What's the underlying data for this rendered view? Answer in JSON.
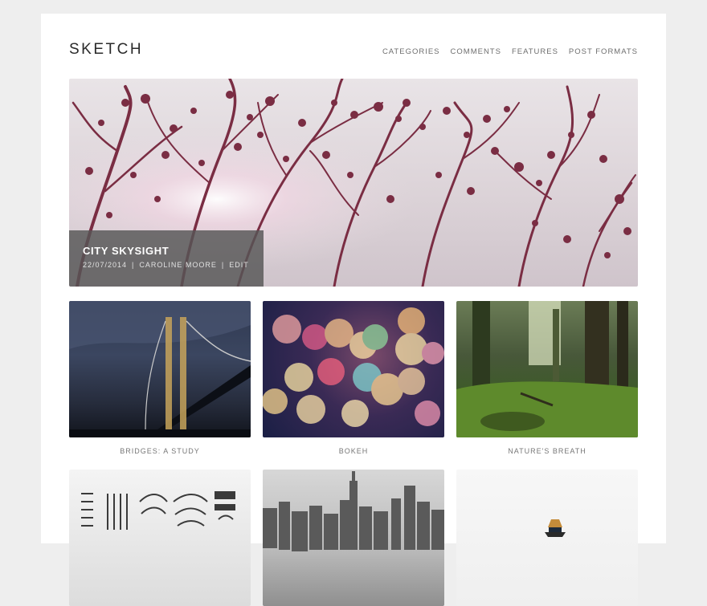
{
  "site": {
    "title": "SKETCH"
  },
  "nav": {
    "items": [
      "CATEGORIES",
      "COMMENTS",
      "FEATURES",
      "POST FORMATS"
    ]
  },
  "featured": {
    "title": "CITY SKYSIGHT",
    "date": "22/07/2014",
    "author": "CAROLINE MOORE",
    "edit_label": "EDIT",
    "separator": "|"
  },
  "projects": [
    {
      "title": "BRIDGES: A STUDY"
    },
    {
      "title": "BOKEH"
    },
    {
      "title": "NATURE'S BREATH"
    }
  ],
  "colors": {
    "background": "#eeeeee",
    "panel": "#ffffff",
    "caption_overlay": "#555555",
    "branch": "#7a2d43"
  }
}
